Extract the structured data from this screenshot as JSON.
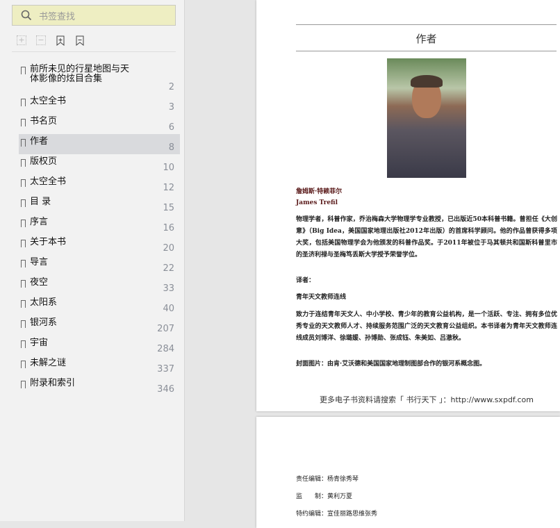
{
  "sidebar": {
    "search_placeholder": "书签查找",
    "items": [
      {
        "label": "前所未见的行星地图与天体影像的炫目合集",
        "page": "2"
      },
      {
        "label": "太空全书",
        "page": "3"
      },
      {
        "label": "书名页",
        "page": "6"
      },
      {
        "label": "作者",
        "page": "8",
        "selected": true
      },
      {
        "label": "版权页",
        "page": "10"
      },
      {
        "label": "太空全书",
        "page": "12"
      },
      {
        "label": "目 录",
        "page": "15"
      },
      {
        "label": "序言",
        "page": "16"
      },
      {
        "label": "关于本书",
        "page": "20"
      },
      {
        "label": "导言",
        "page": "22"
      },
      {
        "label": "夜空",
        "page": "33"
      },
      {
        "label": "太阳系",
        "page": "40"
      },
      {
        "label": "银河系",
        "page": "207"
      },
      {
        "label": "宇宙",
        "page": "284"
      },
      {
        "label": "未解之谜",
        "page": "337"
      },
      {
        "label": "附录和索引",
        "page": "346"
      }
    ]
  },
  "page1": {
    "heading": "作者",
    "author_cn": "詹姆斯·特赖菲尔",
    "author_en": "James Trefil",
    "bio": "物理学者，科普作家，乔治梅森大学物理学专业教授，已出版近50本科普书籍。曾担任《大创意》（Big  Idea，美国国家地理出版社2012年出版）的首席科学顾问。他的作品曾获得多项大奖，包括美国物理学会为他颁发的科普作品奖。于2011年被位于马其顿共和国斯科普里市的圣济利禄与圣梅笃丢斯大学授予荣誉学位。",
    "translator_label": "译者：",
    "translator": "青年天文教师连线",
    "translator_desc": "致力于连结青年天文人、中小学校、青少年的教育公益机构，是一个活跃、专注、拥有多位优秀专业的天文教师人才、持续服务范围广泛的天文教育公益组织。本书译者为青年天文教师连线成员刘博洋、徐璐媛、孙博勋、张成钰、朱美如、吕澈秋。",
    "cover": "封面图片：由肯·艾沃德和美国国家地理制图部合作的银河系概念图。",
    "footer": "更多电子书资料请搜索「 书行天下 」：http://www.sxpdf.com"
  },
  "page2": {
    "lines": [
      "责任编辑：杨青徐秀琴",
      "监　　制：黄利万夏",
      "特约编辑：宣佳丽路思维张秀"
    ]
  }
}
